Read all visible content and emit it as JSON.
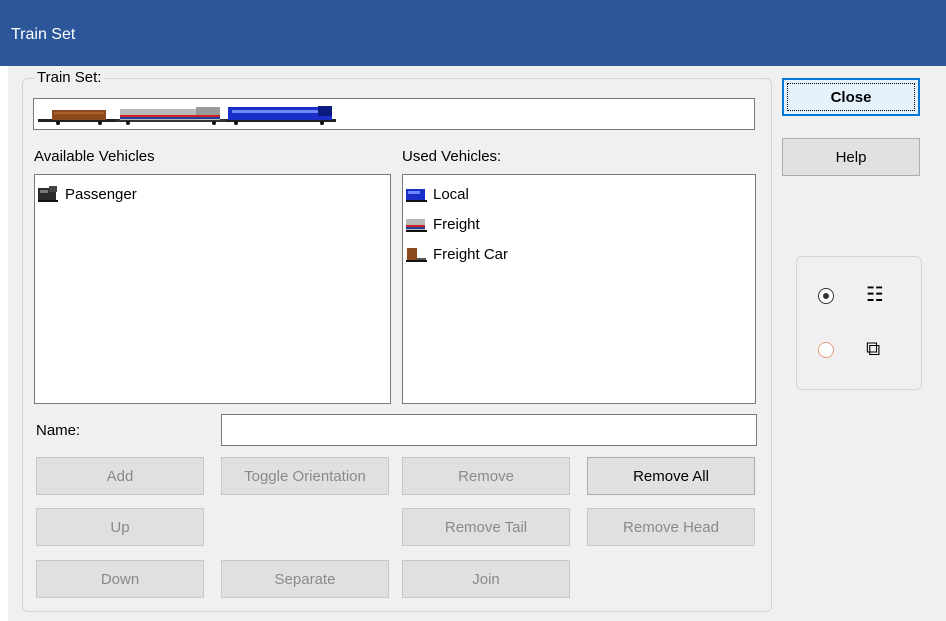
{
  "window": {
    "title": "Train Set"
  },
  "group": {
    "legend": "Train Set:"
  },
  "available": {
    "label": "Available Vehicles",
    "items": [
      {
        "label": "Passenger",
        "icon": "passenger-loco-icon"
      }
    ]
  },
  "used": {
    "label": "Used Vehicles:",
    "items": [
      {
        "label": "Local",
        "icon": "local-loco-icon"
      },
      {
        "label": "Freight",
        "icon": "freight-loco-icon"
      },
      {
        "label": "Freight Car",
        "icon": "freight-car-icon"
      }
    ]
  },
  "name": {
    "label": "Name:",
    "value": ""
  },
  "buttons": {
    "add": "Add",
    "toggle": "Toggle Orientation",
    "remove": "Remove",
    "remove_all": "Remove All",
    "up": "Up",
    "remove_tail": "Remove Tail",
    "remove_head": "Remove Head",
    "down": "Down",
    "separate": "Separate",
    "join": "Join",
    "close": "Close",
    "help": "Help"
  },
  "view": {
    "selected": "list-view",
    "options": [
      "list-view-icon",
      "stacked-view-icon"
    ]
  },
  "colors": {
    "titlebar": "#2b579a",
    "accent": "#0078d7"
  }
}
